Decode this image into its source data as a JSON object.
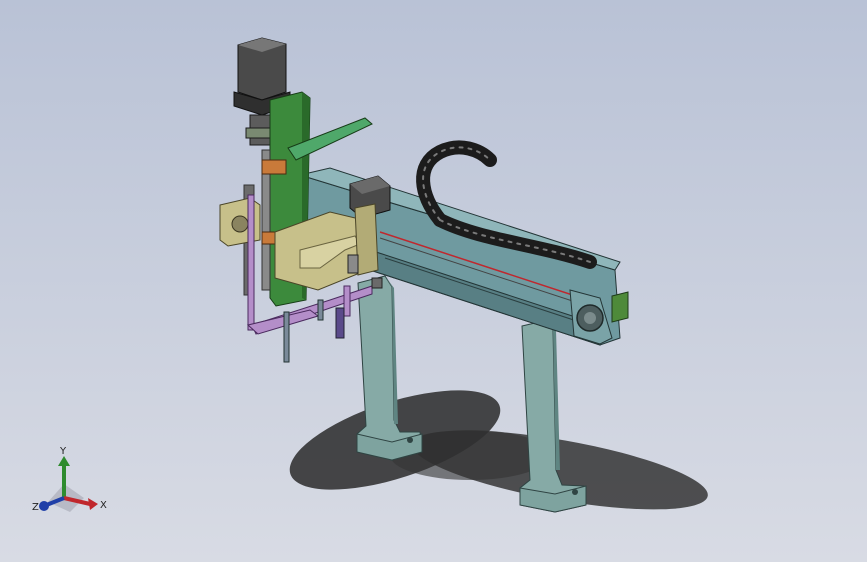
{
  "viewport": {
    "background_top": "#b9c2d6",
    "background_bottom": "#d8dbe4"
  },
  "model": {
    "components": [
      "servo-motor",
      "vertical-axis-plate",
      "horizontal-beam",
      "cable-chain",
      "gripper-bracket",
      "support-pillar-left",
      "support-pillar-right"
    ],
    "colors": {
      "beam": "#6f9aa0",
      "pillar": "#86aaa6",
      "plate_green": "#3c8a3c",
      "bracket_khaki": "#c7c08a",
      "link_purple": "#b48ec9",
      "motor": "#4a4a4a",
      "chain": "#1c1c1c",
      "shadow": "#2a2a2a"
    }
  },
  "triad": {
    "x_label": "X",
    "y_label": "Y",
    "z_label": "Z",
    "x_color": "#c0272d",
    "y_color": "#2e8b2e",
    "z_color": "#1f3fa8"
  }
}
